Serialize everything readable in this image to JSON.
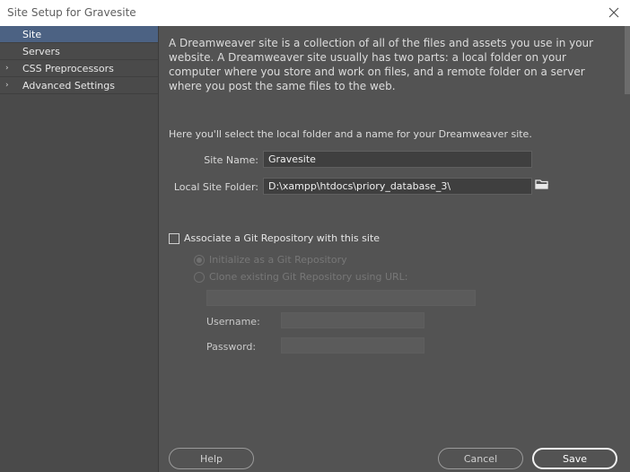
{
  "window": {
    "title": "Site Setup for Gravesite",
    "close_icon": "close-icon"
  },
  "sidebar": {
    "items": [
      {
        "label": "Site",
        "selected": true,
        "expandable": false
      },
      {
        "label": "Servers",
        "selected": false,
        "expandable": false
      },
      {
        "label": "CSS Preprocessors",
        "selected": false,
        "expandable": true
      },
      {
        "label": "Advanced Settings",
        "selected": false,
        "expandable": true
      }
    ],
    "arrow_glyph": "›"
  },
  "main": {
    "intro": "A Dreamweaver site is a collection of all of the files and assets you use in your website. A Dreamweaver site usually has two parts: a local folder on your computer where you store and work on files, and a remote folder on a server where you post the same files to the web.",
    "subtitle": "Here you'll select the local folder and a name for your Dreamweaver site.",
    "site_name_label": "Site Name:",
    "site_name_value": "Gravesite",
    "local_folder_label": "Local Site Folder:",
    "local_folder_value": "D:\\xampp\\htdocs\\priory_database_3\\",
    "folder_icon": "folder-icon",
    "git": {
      "checkbox_label": "Associate a Git Repository with this site",
      "checked": false,
      "init_label": "Initialize as a Git Repository",
      "clone_label": "Clone existing Git Repository using URL:",
      "username_label": "Username:",
      "password_label": "Password:"
    }
  },
  "buttons": {
    "help": "Help",
    "cancel": "Cancel",
    "save": "Save"
  },
  "colors": {
    "background": "#535353",
    "sidebar_bg": "#4a4a4a",
    "selected_bg": "#4c6283",
    "titlebar_bg": "#ffffff"
  }
}
